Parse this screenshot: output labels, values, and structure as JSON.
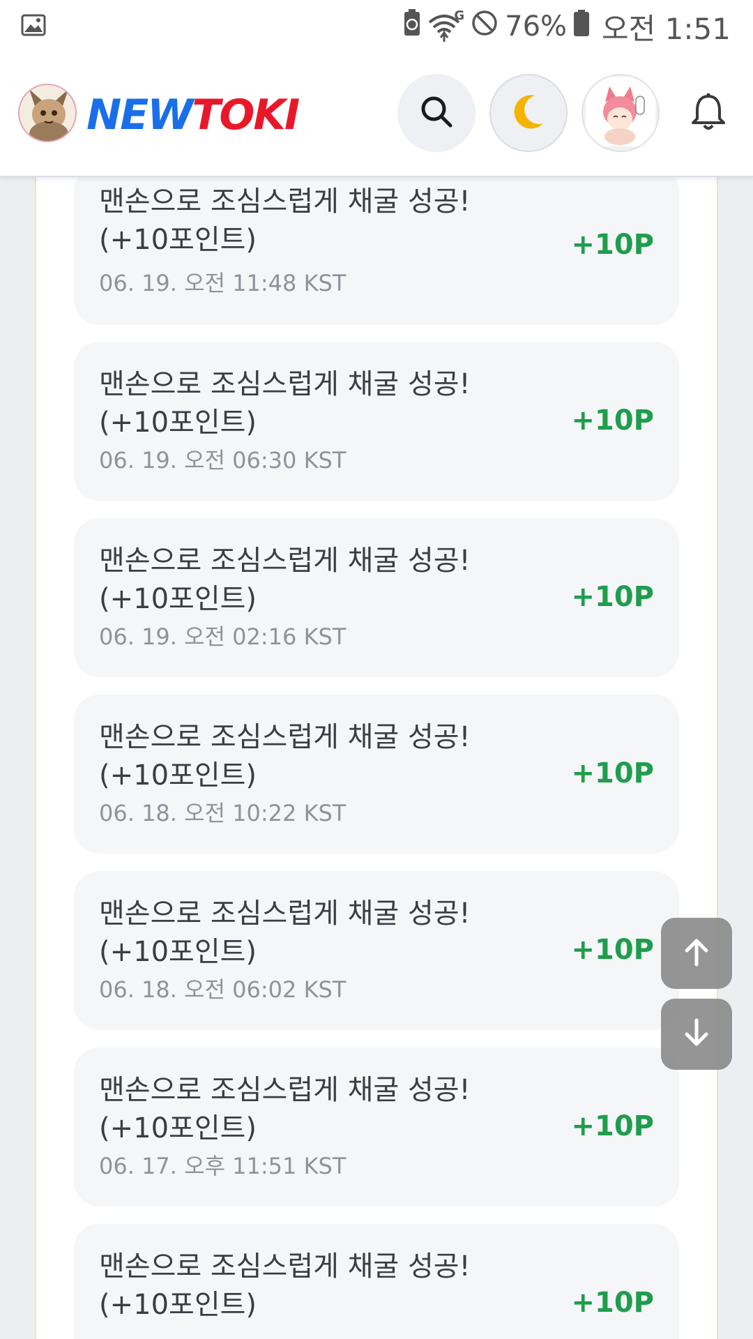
{
  "status_bar": {
    "gallery_icon": "image-icon",
    "battery_saver_icon": "battery-saver-icon",
    "wifi_label": "G",
    "battery_percent": "76%",
    "time": "오전 1:51"
  },
  "header": {
    "logo_new": "NEW",
    "logo_toki": "TOKI",
    "search_icon": "search-icon",
    "theme_icon": "moon-icon",
    "profile_icon": "avatar",
    "bell_icon": "bell-icon"
  },
  "points": {
    "items": [
      {
        "title": "맨손으로 조심스럽게 채굴 성공!(+10포인트)",
        "date": "06. 19. 오전 11:48 KST",
        "amount": "+10P"
      },
      {
        "title": "맨손으로 조심스럽게 채굴 성공!(+10포인트)",
        "date": "06. 19. 오전 06:30 KST",
        "amount": "+10P"
      },
      {
        "title": "맨손으로 조심스럽게 채굴 성공!(+10포인트)",
        "date": "06. 19. 오전 02:16 KST",
        "amount": "+10P"
      },
      {
        "title": "맨손으로 조심스럽게 채굴 성공!(+10포인트)",
        "date": "06. 18. 오전 10:22 KST",
        "amount": "+10P"
      },
      {
        "title": "맨손으로 조심스럽게 채굴 성공!(+10포인트)",
        "date": "06. 18. 오전 06:02 KST",
        "amount": "+10P"
      },
      {
        "title": "맨손으로 조심스럽게 채굴 성공!(+10포인트)",
        "date": "06. 17. 오후 11:51 KST",
        "amount": "+10P"
      },
      {
        "title": "맨손으로 조심스럽게 채굴 성공!(+10포인트)",
        "date": "",
        "amount": "+10P"
      }
    ]
  },
  "scroll": {
    "up_icon": "arrow-up-icon",
    "down_icon": "arrow-down-icon"
  },
  "colors": {
    "accent_green": "#1f9d4d",
    "logo_blue": "#1a6fe8",
    "logo_red": "#e8182a"
  }
}
